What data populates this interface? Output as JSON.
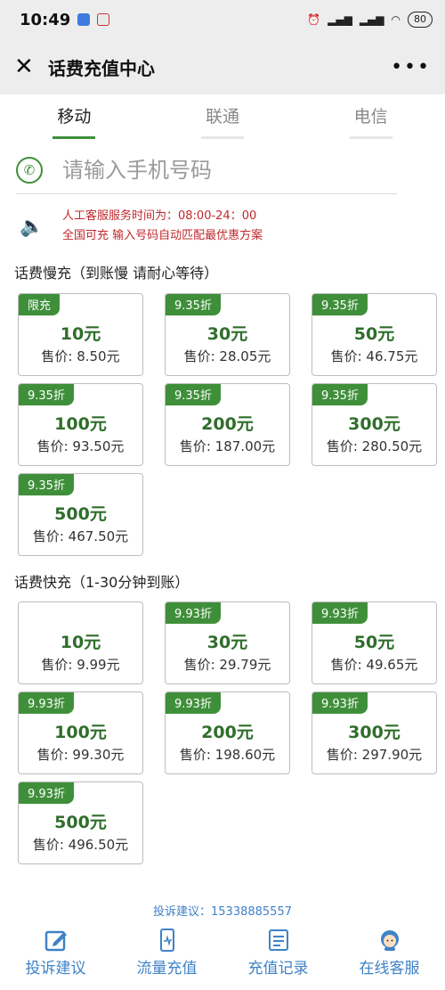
{
  "status": {
    "time": "10:49",
    "battery": "80"
  },
  "header": {
    "title": "话费充值中心"
  },
  "tabs": [
    {
      "label": "移动",
      "active": true
    },
    {
      "label": "联通",
      "active": false
    },
    {
      "label": "电信",
      "active": false
    }
  ],
  "phone": {
    "placeholder": "请输入手机号码"
  },
  "notice": {
    "line1": "人工客服服务时间为：08:00-24：00",
    "line2": "全国可充 输入号码自动匹配最优惠方案"
  },
  "slow": {
    "title": "话费慢充（到账慢 请耐心等待）",
    "cards": [
      {
        "badge": "限充",
        "face": "10元",
        "price": "售价: 8.50元"
      },
      {
        "badge": "9.35折",
        "face": "30元",
        "price": "售价: 28.05元"
      },
      {
        "badge": "9.35折",
        "face": "50元",
        "price": "售价: 46.75元"
      },
      {
        "badge": "9.35折",
        "face": "100元",
        "price": "售价: 93.50元"
      },
      {
        "badge": "9.35折",
        "face": "200元",
        "price": "售价: 187.00元"
      },
      {
        "badge": "9.35折",
        "face": "300元",
        "price": "售价: 280.50元"
      },
      {
        "badge": "9.35折",
        "face": "500元",
        "price": "售价: 467.50元"
      }
    ]
  },
  "fast": {
    "title": "话费快充（1-30分钟到账）",
    "cards": [
      {
        "badge": "",
        "face": "10元",
        "price": "售价: 9.99元"
      },
      {
        "badge": "9.93折",
        "face": "30元",
        "price": "售价: 29.79元"
      },
      {
        "badge": "9.93折",
        "face": "50元",
        "price": "售价: 49.65元"
      },
      {
        "badge": "9.93折",
        "face": "100元",
        "price": "售价: 99.30元"
      },
      {
        "badge": "9.93折",
        "face": "200元",
        "price": "售价: 198.60元"
      },
      {
        "badge": "9.93折",
        "face": "300元",
        "price": "售价: 297.90元"
      },
      {
        "badge": "9.93折",
        "face": "500元",
        "price": "售价: 496.50元"
      }
    ]
  },
  "complaint": "投诉建议：15338885557",
  "bottom_nav": [
    {
      "label": "投诉建议",
      "icon": "edit-icon"
    },
    {
      "label": "流量充值",
      "icon": "phone-data-icon"
    },
    {
      "label": "充值记录",
      "icon": "record-icon"
    },
    {
      "label": "在线客服",
      "icon": "service-agent-icon"
    }
  ],
  "colors": {
    "accent": "#3f8f3a",
    "notice": "#c0282d",
    "link": "#3f82c7"
  }
}
